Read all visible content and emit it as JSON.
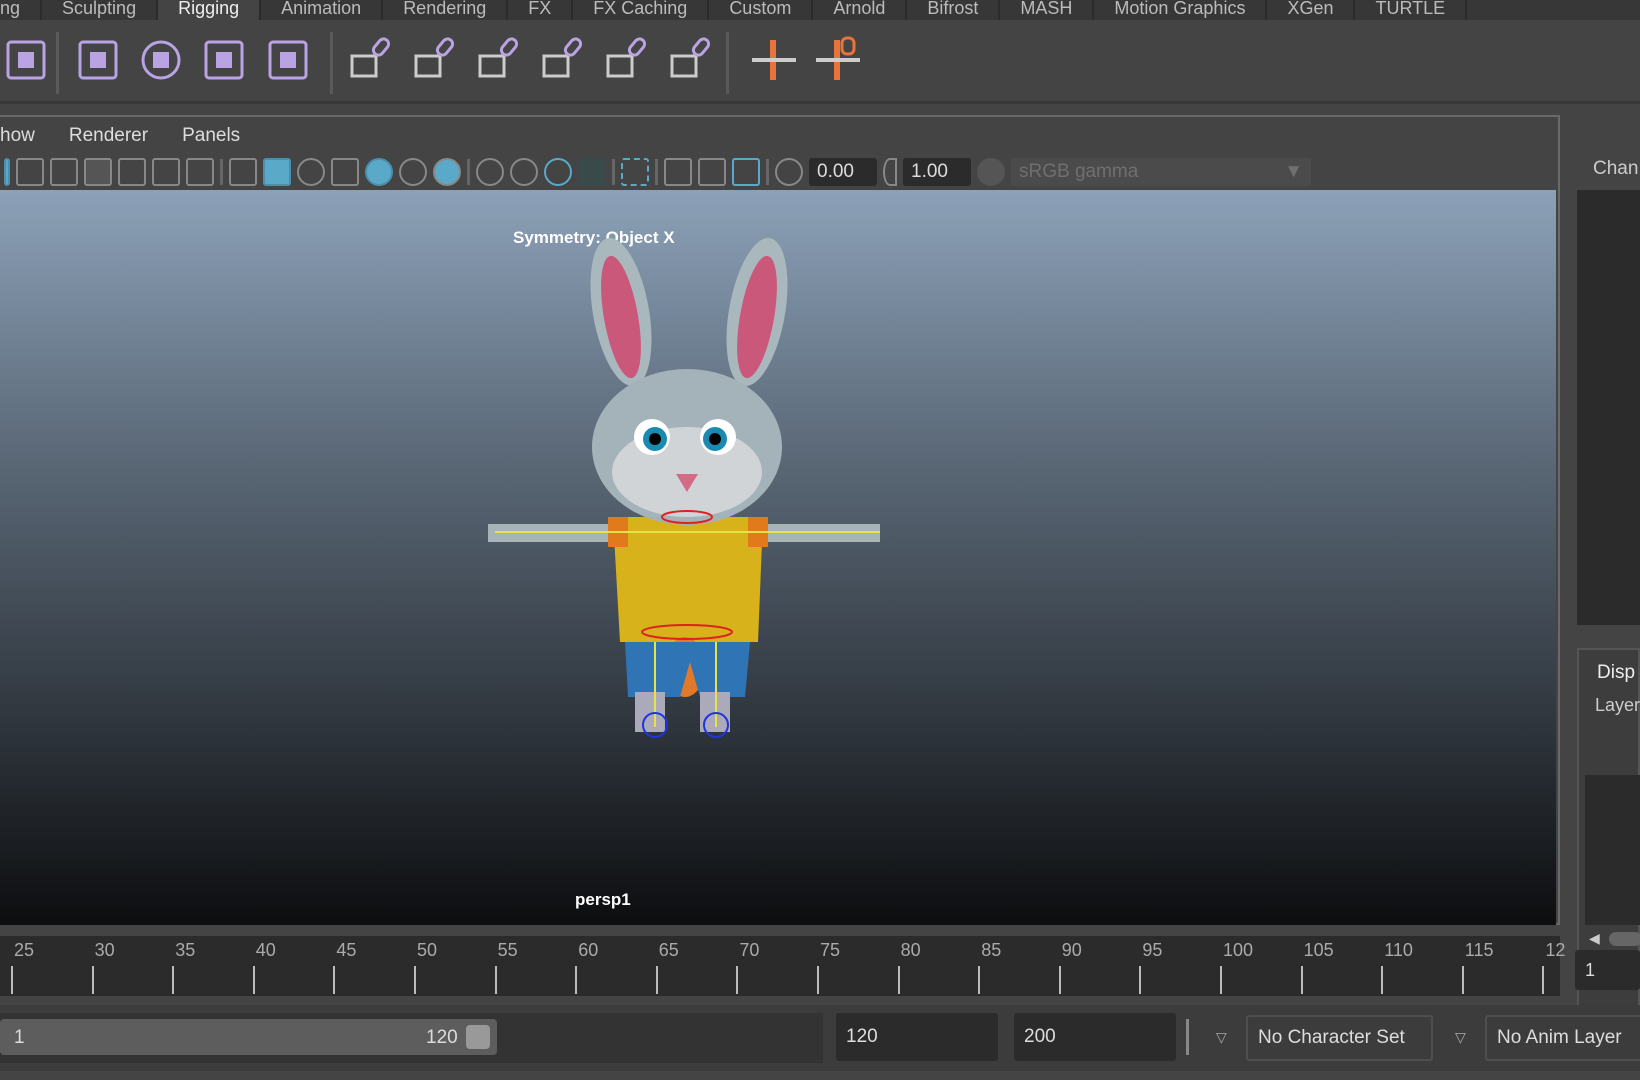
{
  "tabs": [
    "ng",
    "Sculpting",
    "Rigging",
    "Animation",
    "Rendering",
    "FX",
    "FX Caching",
    "Custom",
    "Arnold",
    "Bifrost",
    "MASH",
    "Motion Graphics",
    "XGen",
    "TURTLE"
  ],
  "active_tab": "Rigging",
  "shelf": [
    {
      "name": "humanik-icon",
      "color": "#b9a3e3"
    },
    {
      "name": "skin-paint-icon",
      "color": "#b9a3e3"
    },
    {
      "name": "sculpt-deformer-icon",
      "color": "#b9a3e3"
    },
    {
      "name": "lattice-icon",
      "color": "#b9a3e3"
    },
    {
      "name": "cluster-icon",
      "color": "#b9a3e3"
    },
    {
      "name": "parent-constraint-icon",
      "color": "#b9a3e3"
    },
    {
      "name": "point-constraint-icon",
      "color": "#b9a3e3"
    },
    {
      "name": "orient-constraint-icon",
      "color": "#b9a3e3"
    },
    {
      "name": "scale-constraint-icon",
      "color": "#b9a3e3"
    },
    {
      "name": "aim-constraint-icon",
      "color": "#b9a3e3"
    },
    {
      "name": "pole-vector-constraint-icon",
      "color": "#b9a3e3"
    },
    {
      "name": "joint-tool-icon",
      "color": "#e8743b"
    },
    {
      "name": "ik-handle-icon",
      "color": "#e8743b"
    }
  ],
  "panel": {
    "menus": [
      "how",
      "Renderer",
      "Panels"
    ],
    "exposure": "0.00",
    "gamma_value": "1.00",
    "color_space": "sRGB gamma"
  },
  "viewport": {
    "symmetry": "Symmetry: Object X",
    "camera": "persp1"
  },
  "right_panel": {
    "channel": "Chan",
    "display": "Disp",
    "layers": "Layer"
  },
  "timeline": {
    "ticks": [
      25,
      30,
      35,
      40,
      45,
      50,
      55,
      60,
      65,
      70,
      75,
      80,
      85,
      90,
      95,
      100,
      105,
      110,
      115,
      "12"
    ],
    "current_frame": "1"
  },
  "range": {
    "start": "1",
    "end": "120",
    "anim_end": "120",
    "max": "200",
    "character_set": "No Character Set",
    "anim_layer": "No Anim Layer"
  },
  "colors": {
    "accent": "#5aa9c9",
    "rig": "#b9a3e3",
    "joint": "#e8743b"
  }
}
